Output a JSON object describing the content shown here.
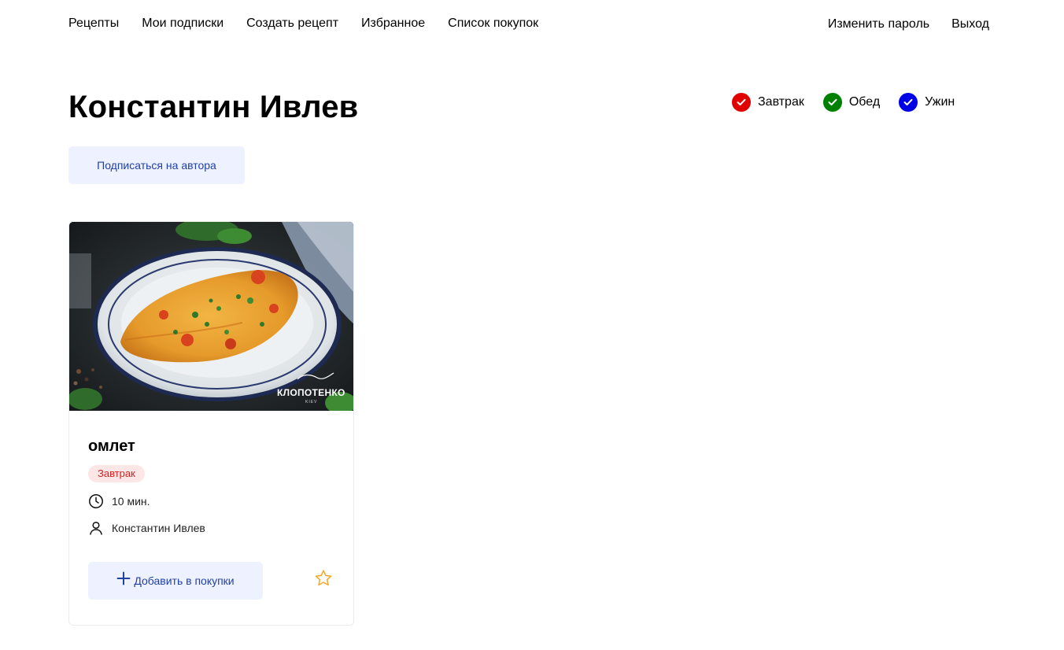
{
  "nav": {
    "left": [
      "Рецепты",
      "Мои подписки",
      "Создать рецепт",
      "Избранное",
      "Список покупок"
    ],
    "change_password": "Изменить пароль",
    "logout": "Выход"
  },
  "page": {
    "title": "Константин Ивлев",
    "subscribe_label": "Подписаться на автора"
  },
  "filters": [
    {
      "label": "Завтрак",
      "color": "#e00000"
    },
    {
      "label": "Обед",
      "color": "#008000"
    },
    {
      "label": "Ужин",
      "color": "#0000e6"
    }
  ],
  "recipe": {
    "title": "омлет",
    "tag": "Завтрак",
    "tag_color": "#d42121",
    "time": "10 мин.",
    "author": "Константин Ивлев",
    "add_label": "Добавить в покупки",
    "watermark": "КЛОПОТЕНКО",
    "watermark_sub": "KIEV",
    "favorite_color": "#f5a623",
    "accent_color": "#2141a8"
  }
}
